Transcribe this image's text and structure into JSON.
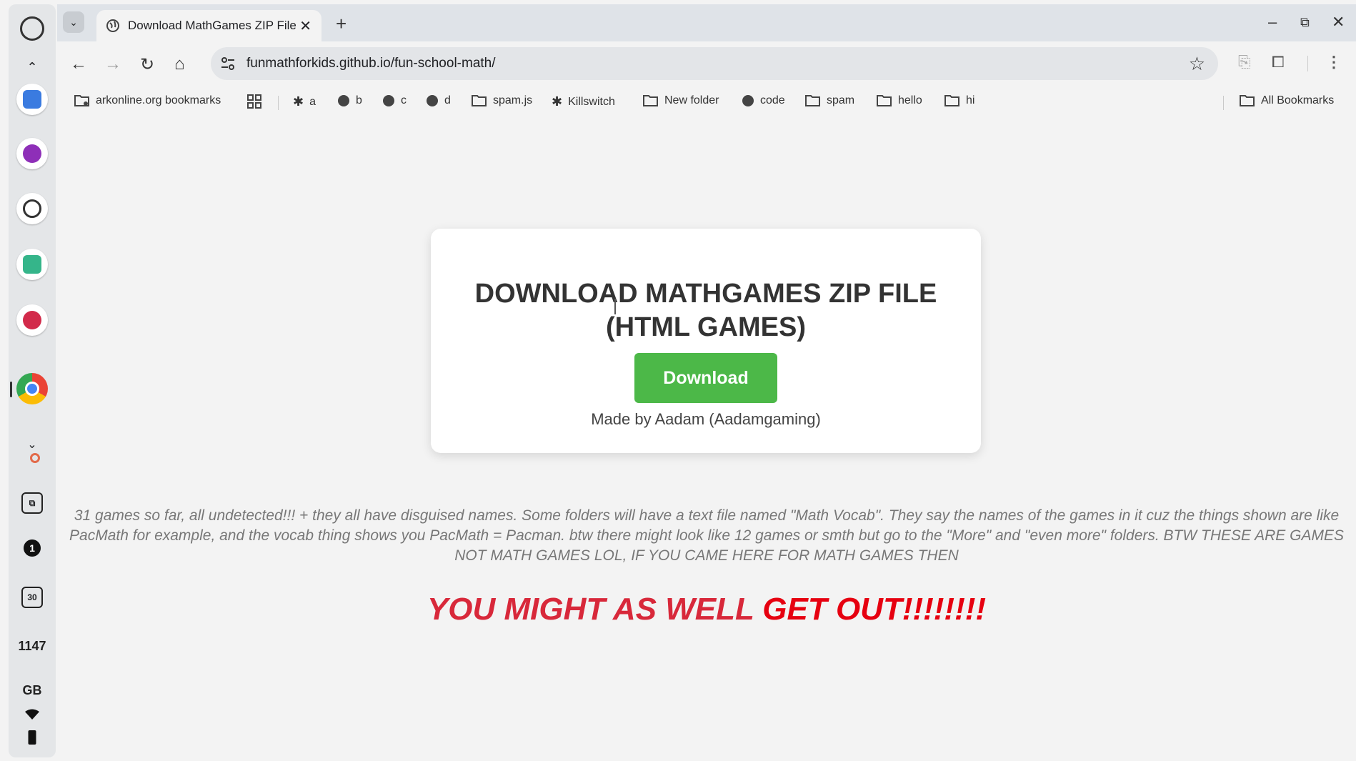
{
  "shelf": {
    "clock": [
      "11",
      "47"
    ],
    "locale": "GB",
    "calendar_day": "30",
    "notification_count": "1"
  },
  "browser": {
    "tab": {
      "title": "Download MathGames ZIP File"
    },
    "omnibox": {
      "url": "funmathforkids.github.io/fun-school-math/"
    },
    "bookmarks": [
      {
        "label": "arkonline.org bookmarks",
        "icon": "managed-folder-icon"
      },
      {
        "label": "a",
        "icon": "extension-icon"
      },
      {
        "label": "b",
        "icon": "globe-icon"
      },
      {
        "label": "c",
        "icon": "globe-icon"
      },
      {
        "label": "d",
        "icon": "globe-icon"
      },
      {
        "label": "spam.js",
        "icon": "folder-icon"
      },
      {
        "label": "Killswitch",
        "icon": "extension-icon"
      },
      {
        "label": "New folder",
        "icon": "folder-icon"
      },
      {
        "label": "code",
        "icon": "globe-icon"
      },
      {
        "label": "spam",
        "icon": "folder-icon"
      },
      {
        "label": "hello",
        "icon": "folder-icon"
      },
      {
        "label": "hi",
        "icon": "folder-icon"
      }
    ],
    "all_bookmarks": "All Bookmarks"
  },
  "page": {
    "heading": "DOWNLOAD MATHGAMES ZIP FILE (HTML GAMES)",
    "download_label": "Download",
    "credit": "Made by Aadam (Aadamgaming)",
    "description": "31 games so far, all undetected!!! + they all have disguised names. Some folders will have a text file named \"Math Vocab\". They say the names of the games in it cuz the things shown are like PacMath for example, and the vocab thing shows you PacMath = Pacman. btw there might look like 12 games or smth but go to the \"More\" and \"even more\" folders. BTW THESE ARE GAMES NOT MATH GAMES LOL, IF YOU CAME HERE FOR MATH GAMES THEN",
    "shout_part1": "YOU MIGHT AS WELL ",
    "shout_part2": "GET OUT!!!!!!!!"
  },
  "colors": {
    "download_button": "#4cb848",
    "shout_red": "#d8283a",
    "shout_bright_red": "#e60010"
  }
}
